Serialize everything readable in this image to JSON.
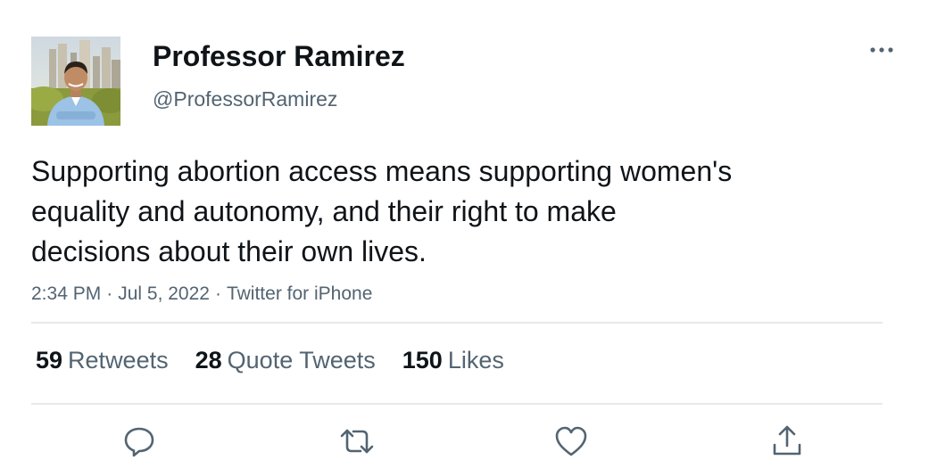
{
  "author": {
    "display_name": "Professor Ramirez",
    "handle": "@ProfessorRamirez",
    "avatar": "profile-photo"
  },
  "tweet": {
    "text": "Supporting abortion access means supporting women's\nequality and autonomy, and their right to make\ndecisions about their own lives.",
    "time": "2:34 PM",
    "date": "Jul 5, 2022",
    "source": "Twitter for iPhone",
    "separator": "·"
  },
  "stats": {
    "retweets": {
      "count": "59",
      "label": "Retweets"
    },
    "quote_tweets": {
      "count": "28",
      "label": "Quote Tweets"
    },
    "likes": {
      "count": "150",
      "label": "Likes"
    }
  },
  "actions": [
    "reply-icon",
    "retweet-icon",
    "like-icon",
    "share-icon"
  ],
  "menu_icon": "more-icon",
  "colors": {
    "text": "#0f1419",
    "secondary": "#536471",
    "divider": "#e6e9ec",
    "icon": "#536471"
  }
}
